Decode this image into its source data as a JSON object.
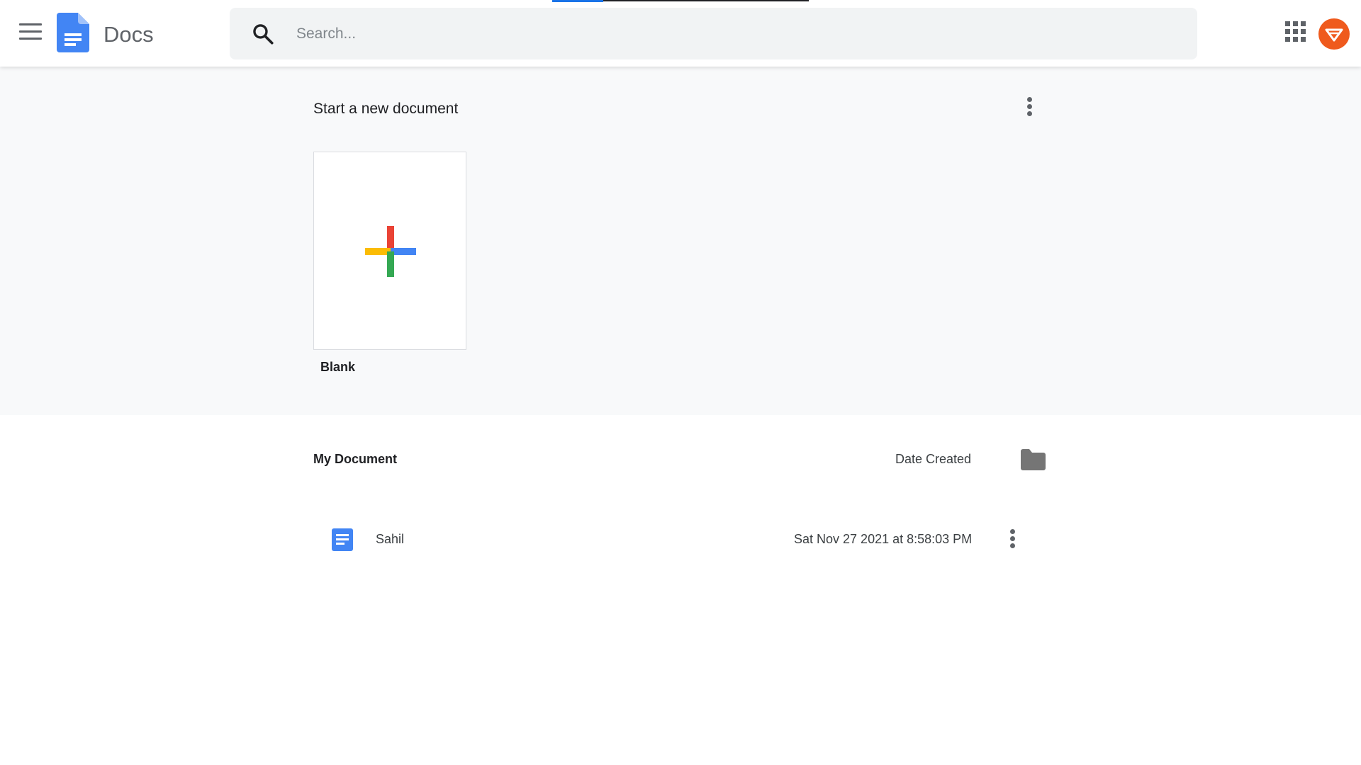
{
  "header": {
    "app_title": "Docs",
    "search": {
      "placeholder": "Search...",
      "value": ""
    },
    "icons": [
      "menu-icon",
      "docs-logo-icon",
      "search-icon",
      "apps-grid-icon",
      "account-avatar"
    ],
    "brand_color": "#4285f4",
    "avatar_color": "#ef5a1d"
  },
  "templates": {
    "title": "Start a new document",
    "items": [
      {
        "label": "Blank",
        "icon": "multicolor-plus-icon"
      }
    ]
  },
  "documents": {
    "title": "My Document",
    "date_column": "Date Created",
    "rows": [
      {
        "name": "Sahil",
        "date": "Sat Nov 27 2021 at 8:58:03 PM",
        "icon": "document-icon"
      }
    ]
  },
  "colors": {
    "plus_red": "#ea4335",
    "plus_blue": "#4285f4",
    "plus_yellow": "#fbbc04",
    "plus_green": "#34a853",
    "section_background": "#f8f9fa"
  }
}
